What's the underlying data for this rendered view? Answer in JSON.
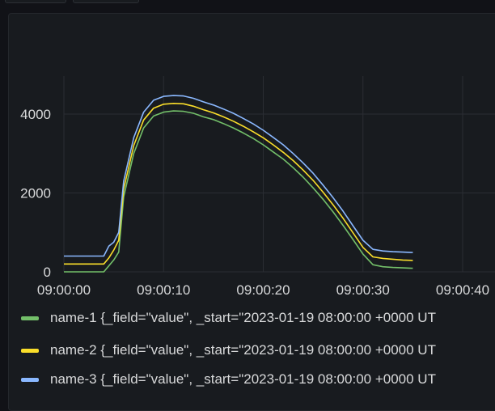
{
  "chart_data": {
    "type": "line",
    "title": "",
    "xlabel": "",
    "ylabel": "",
    "xlim": [
      "09:00:00",
      "09:00:40"
    ],
    "ylim": [
      0,
      5000
    ],
    "x_ticks": [
      "09:00:00",
      "09:00:10",
      "09:00:20",
      "09:00:30",
      "09:00:40"
    ],
    "y_ticks": [
      "0",
      "2000",
      "4000"
    ],
    "grid": true,
    "legend_position": "bottom",
    "series": [
      {
        "name": "name-1 {_field=\"value\", _start=\"2023-01-19 08:00:00 +0000 UT",
        "color": "#73bf69",
        "points": [
          [
            "09:00:00",
            0
          ],
          [
            "09:00:01",
            0
          ],
          [
            "09:00:02",
            0
          ],
          [
            "09:00:03",
            0
          ],
          [
            "09:00:04",
            0
          ],
          [
            "09:00:04.5",
            150
          ],
          [
            "09:00:05",
            300
          ],
          [
            "09:00:05.5",
            500
          ],
          [
            "09:00:06",
            1900
          ],
          [
            "09:00:07",
            3000
          ],
          [
            "09:00:08",
            3650
          ],
          [
            "09:00:09",
            3950
          ],
          [
            "09:00:10",
            4050
          ],
          [
            "09:00:11",
            4080
          ],
          [
            "09:00:12",
            4070
          ],
          [
            "09:00:13",
            4020
          ],
          [
            "09:00:14",
            3930
          ],
          [
            "09:00:15",
            3860
          ],
          [
            "09:00:16",
            3760
          ],
          [
            "09:00:17",
            3650
          ],
          [
            "09:00:18",
            3520
          ],
          [
            "09:00:19",
            3380
          ],
          [
            "09:00:20",
            3220
          ],
          [
            "09:00:21",
            3040
          ],
          [
            "09:00:22",
            2860
          ],
          [
            "09:00:23",
            2640
          ],
          [
            "09:00:24",
            2400
          ],
          [
            "09:00:25",
            2130
          ],
          [
            "09:00:26",
            1840
          ],
          [
            "09:00:27",
            1520
          ],
          [
            "09:00:28",
            1180
          ],
          [
            "09:00:29",
            820
          ],
          [
            "09:00:30",
            450
          ],
          [
            "09:00:31",
            180
          ],
          [
            "09:00:32",
            130
          ],
          [
            "09:00:33",
            110
          ],
          [
            "09:00:34",
            100
          ],
          [
            "09:00:35",
            90
          ]
        ]
      },
      {
        "name": "name-2 {_field=\"value\", _start=\"2023-01-19 08:00:00 +0000 UT",
        "color": "#fade2a",
        "points": [
          [
            "09:00:00",
            200
          ],
          [
            "09:00:01",
            200
          ],
          [
            "09:00:02",
            200
          ],
          [
            "09:00:03",
            200
          ],
          [
            "09:00:04",
            200
          ],
          [
            "09:00:04.5",
            350
          ],
          [
            "09:00:05",
            550
          ],
          [
            "09:00:05.5",
            800
          ],
          [
            "09:00:06",
            2100
          ],
          [
            "09:00:07",
            3200
          ],
          [
            "09:00:08",
            3850
          ],
          [
            "09:00:09",
            4150
          ],
          [
            "09:00:10",
            4250
          ],
          [
            "09:00:11",
            4270
          ],
          [
            "09:00:12",
            4260
          ],
          [
            "09:00:13",
            4200
          ],
          [
            "09:00:14",
            4110
          ],
          [
            "09:00:15",
            4030
          ],
          [
            "09:00:16",
            3930
          ],
          [
            "09:00:17",
            3820
          ],
          [
            "09:00:18",
            3690
          ],
          [
            "09:00:19",
            3550
          ],
          [
            "09:00:20",
            3400
          ],
          [
            "09:00:21",
            3220
          ],
          [
            "09:00:22",
            3030
          ],
          [
            "09:00:23",
            2820
          ],
          [
            "09:00:24",
            2580
          ],
          [
            "09:00:25",
            2320
          ],
          [
            "09:00:26",
            2020
          ],
          [
            "09:00:27",
            1700
          ],
          [
            "09:00:28",
            1360
          ],
          [
            "09:00:29",
            990
          ],
          [
            "09:00:30",
            620
          ],
          [
            "09:00:31",
            380
          ],
          [
            "09:00:32",
            340
          ],
          [
            "09:00:33",
            320
          ],
          [
            "09:00:34",
            300
          ],
          [
            "09:00:35",
            290
          ]
        ]
      },
      {
        "name": "name-3 {_field=\"value\", _start=\"2023-01-19 08:00:00 +0000 UT",
        "color": "#8ab8ff",
        "points": [
          [
            "09:00:00",
            400
          ],
          [
            "09:00:01",
            400
          ],
          [
            "09:00:02",
            400
          ],
          [
            "09:00:03",
            400
          ],
          [
            "09:00:04",
            400
          ],
          [
            "09:00:04.5",
            650
          ],
          [
            "09:00:05",
            750
          ],
          [
            "09:00:05.5",
            1000
          ],
          [
            "09:00:06",
            2300
          ],
          [
            "09:00:07",
            3400
          ],
          [
            "09:00:08",
            4050
          ],
          [
            "09:00:09",
            4350
          ],
          [
            "09:00:10",
            4450
          ],
          [
            "09:00:11",
            4470
          ],
          [
            "09:00:12",
            4460
          ],
          [
            "09:00:13",
            4400
          ],
          [
            "09:00:14",
            4310
          ],
          [
            "09:00:15",
            4230
          ],
          [
            "09:00:16",
            4130
          ],
          [
            "09:00:17",
            4020
          ],
          [
            "09:00:18",
            3890
          ],
          [
            "09:00:19",
            3750
          ],
          [
            "09:00:20",
            3590
          ],
          [
            "09:00:21",
            3410
          ],
          [
            "09:00:22",
            3220
          ],
          [
            "09:00:23",
            3000
          ],
          [
            "09:00:24",
            2760
          ],
          [
            "09:00:25",
            2500
          ],
          [
            "09:00:26",
            2200
          ],
          [
            "09:00:27",
            1880
          ],
          [
            "09:00:28",
            1540
          ],
          [
            "09:00:29",
            1170
          ],
          [
            "09:00:30",
            800
          ],
          [
            "09:00:31",
            570
          ],
          [
            "09:00:32",
            530
          ],
          [
            "09:00:33",
            510
          ],
          [
            "09:00:34",
            500
          ],
          [
            "09:00:35",
            490
          ]
        ]
      }
    ]
  }
}
